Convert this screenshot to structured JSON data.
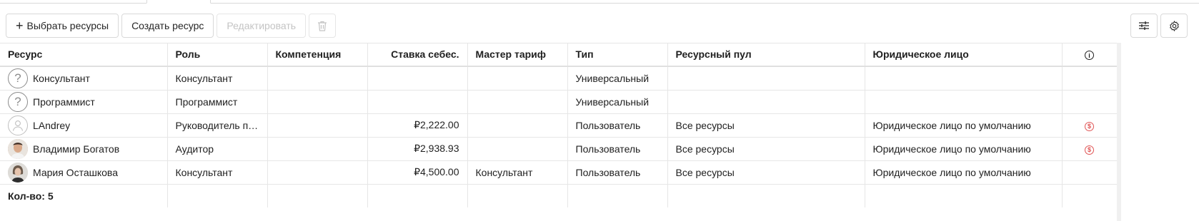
{
  "toolbar": {
    "select_resources_label": "Выбрать ресурсы",
    "create_resource_label": "Создать ресурс",
    "edit_label": "Редактировать"
  },
  "table": {
    "columns": {
      "resource": "Ресурс",
      "role": "Роль",
      "competence": "Компетенция",
      "cost_rate": "Ставка себес.",
      "master_rate": "Мастер тариф",
      "type": "Тип",
      "resource_pool": "Ресурсный пул",
      "legal_entity": "Юридическое лицо"
    },
    "rows": [
      {
        "resource": "Консультант",
        "role": "Консультант",
        "competence": "",
        "cost_rate": "",
        "master_rate": "",
        "type": "Универсальный",
        "resource_pool": "",
        "legal_entity": "",
        "avatar": "question-icon"
      },
      {
        "resource": "Программист",
        "role": "Программист",
        "competence": "",
        "cost_rate": "",
        "master_rate": "",
        "type": "Универсальный",
        "resource_pool": "",
        "legal_entity": "",
        "avatar": "question-icon"
      },
      {
        "resource": "LAndrey",
        "role": "Руководитель пр...",
        "competence": "",
        "cost_rate": "₽2,222.00",
        "master_rate": "",
        "type": "Пользователь",
        "resource_pool": "Все ресурсы",
        "legal_entity": "Юридическое лицо по умолчанию",
        "avatar": "user-icon",
        "status_icon": "$"
      },
      {
        "resource": "Владимир Богатов",
        "role": "Аудитор",
        "competence": "",
        "cost_rate": "₽2,938.93",
        "master_rate": "",
        "type": "Пользователь",
        "resource_pool": "Все ресурсы",
        "legal_entity": "Юридическое лицо по умолчанию",
        "avatar": "photo",
        "status_icon": "$"
      },
      {
        "resource": "Мария Осташкова",
        "role": "Консультант",
        "competence": "",
        "cost_rate": "₽4,500.00",
        "master_rate": "Консультант",
        "type": "Пользователь",
        "resource_pool": "Все ресурсы",
        "legal_entity": "Юридическое лицо по умолчанию",
        "avatar": "photo",
        "status_icon": ""
      }
    ],
    "footer": {
      "count": "Кол-во: 5"
    }
  },
  "colors": {
    "warning_icon": "#e05555",
    "border": "#e6e6e6",
    "disabled_text": "#c4c4c4"
  }
}
